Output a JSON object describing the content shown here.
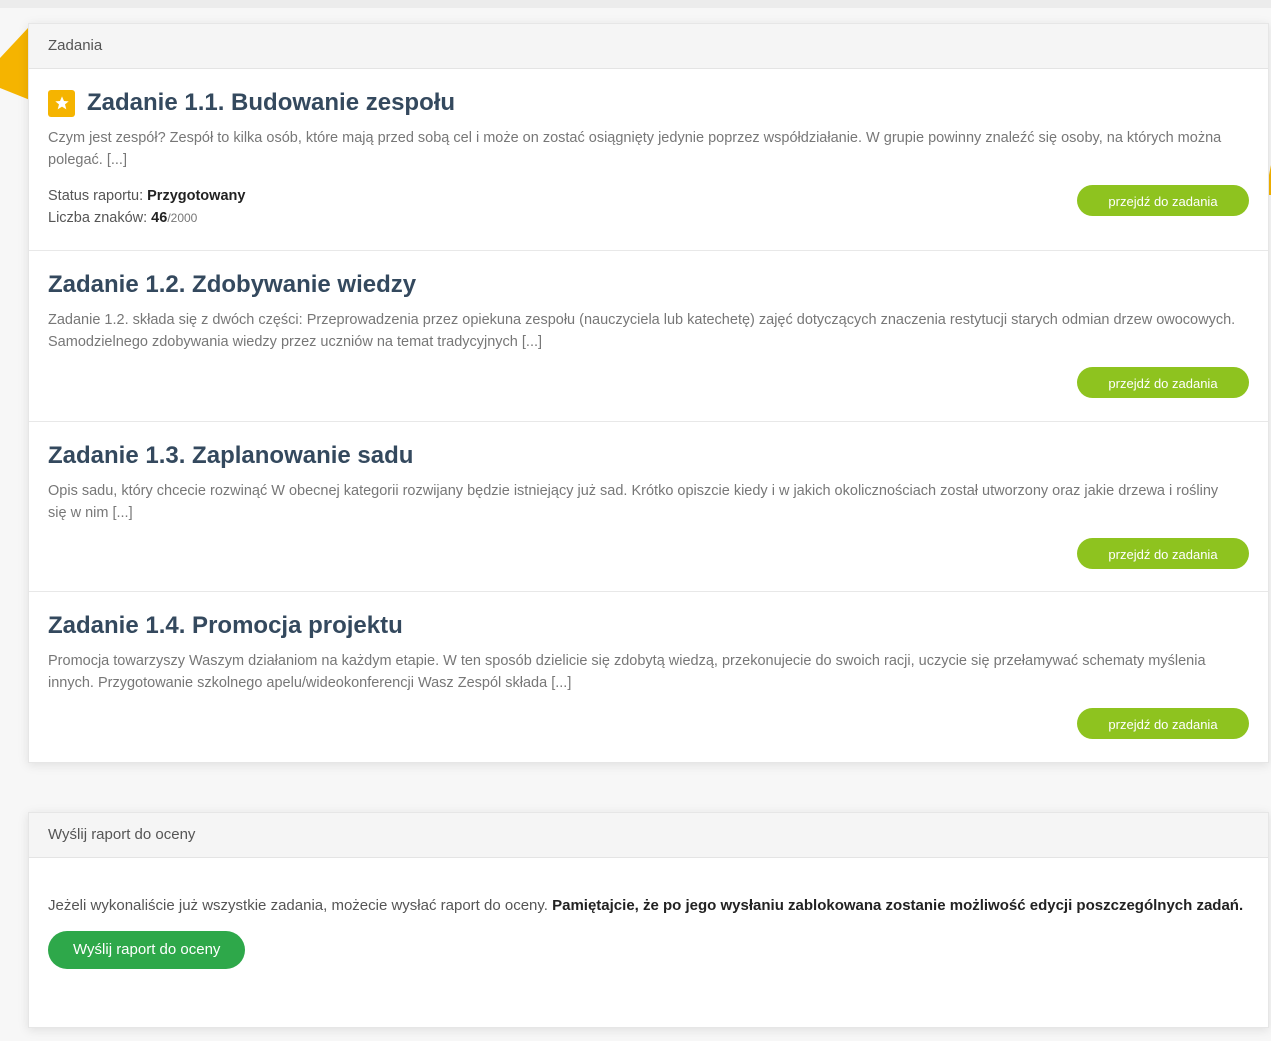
{
  "tasks_panel": {
    "header": "Zadania",
    "tasks": [
      {
        "title": "Zadanie 1.1. Budowanie zespołu",
        "description": "Czym jest zespół? Zespół to kilka osób, które mają przed sobą cel i może on zostać osiągnięty jedynie poprzez współdziałanie. W grupie powinny znaleźć się osoby, na których można polegać. [...]",
        "status_label": "Status raportu: ",
        "status_value": "Przygotowany",
        "chars_label": "Liczba znaków: ",
        "chars_value": "46",
        "chars_max": "/2000",
        "button": "przejdź do zadania",
        "starred": true
      },
      {
        "title": "Zadanie 1.2. Zdobywanie wiedzy",
        "description": "Zadanie 1.2. składa się z dwóch części: Przeprowadzenia przez opiekuna zespołu (nauczyciela lub katechetę) zajęć dotyczących znaczenia restytucji starych odmian drzew owocowych. Samodzielnego zdobywania wiedzy przez uczniów na temat tradycyjnych [...]",
        "button": "przejdź do zadania"
      },
      {
        "title": "Zadanie 1.3. Zaplanowanie sadu",
        "description": "Opis sadu, który chcecie rozwinąć  W obecnej kategorii rozwijany będzie istniejący już sad. Krótko opiszcie kiedy i w jakich okolicznościach został utworzony oraz jakie drzewa i rośliny się w nim [...]",
        "button": "przejdź do zadania"
      },
      {
        "title": "Zadanie 1.4. Promocja projektu",
        "description": "Promocja towarzyszy Waszym działaniom na każdym etapie. W ten sposób dzielicie się zdobytą wiedzą, przekonujecie do swoich racji, uczycie się przełamywać schematy myślenia innych. Przygotowanie szkolnego apelu/wideokonferencji Wasz Zespól składa [...]",
        "button": "przejdź do zadania"
      }
    ]
  },
  "send_panel": {
    "header": "Wyślij raport do oceny",
    "text_normal": "Jeżeli wykonaliście już wszystkie zadania, możecie wysłać raport do oceny. ",
    "text_bold": "Pamiętajcie, że po jego wysłaniu zablokowana zostanie możliwość edycji poszczególnych zadań.",
    "button": "Wyślij raport do oceny"
  },
  "colors": {
    "accent_green": "#8ec31f",
    "send_green": "#2ea84a",
    "star_yellow": "#f5b400"
  },
  "icons": [
    "star-icon",
    "arrow-icon"
  ]
}
